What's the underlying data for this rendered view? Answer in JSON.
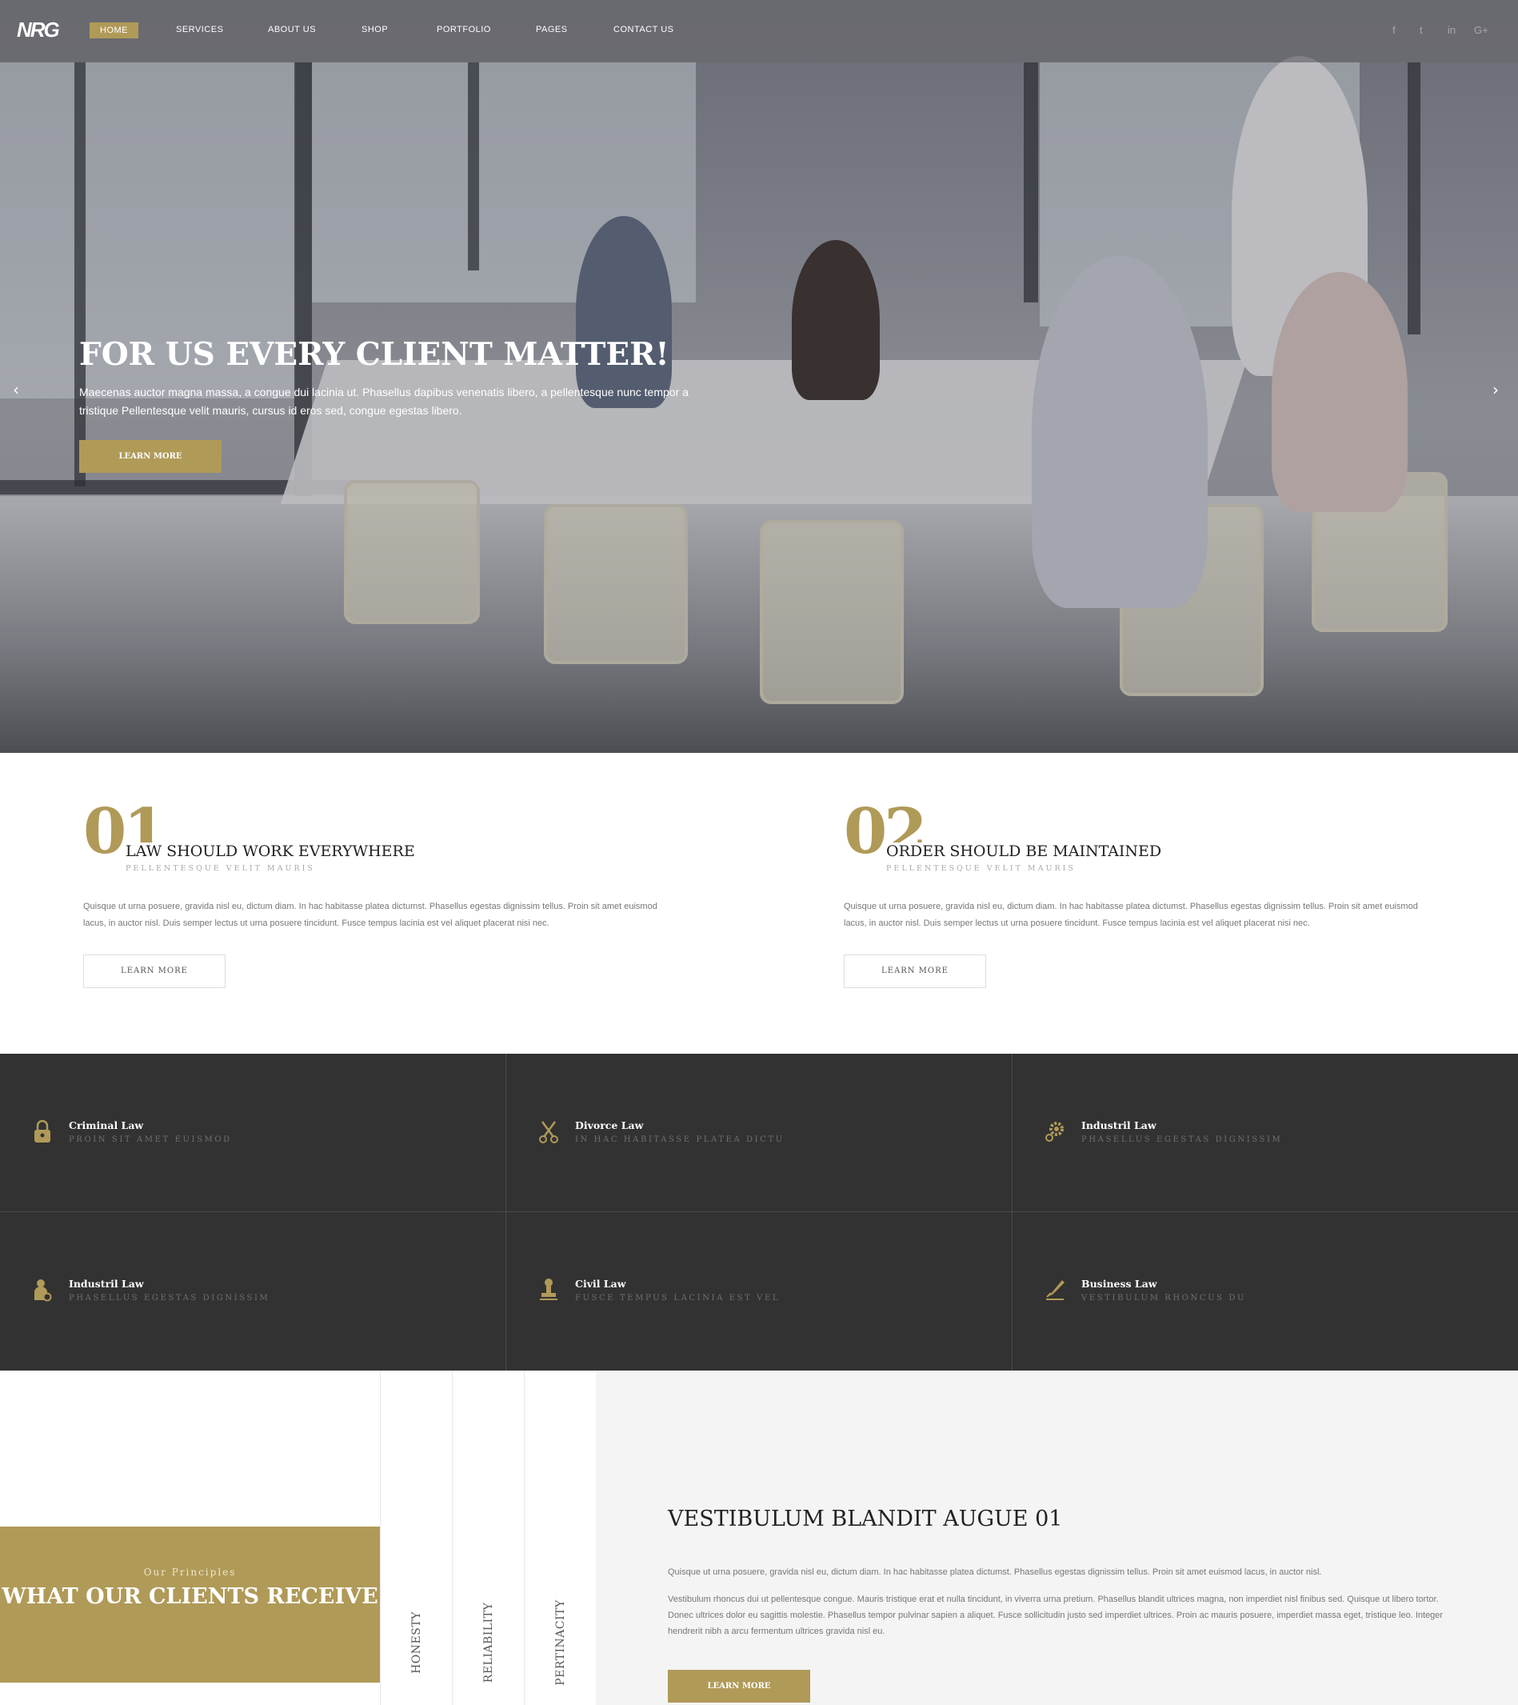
{
  "brand": {
    "logo_text": "NRG",
    "accent_color": "#b09a58",
    "dark_color": "#323232"
  },
  "nav": {
    "items": [
      {
        "label": "HOME",
        "active": true
      },
      {
        "label": "SERVICES"
      },
      {
        "label": "ABOUT US"
      },
      {
        "label": "SHOP"
      },
      {
        "label": "PORTFOLIO"
      },
      {
        "label": "PAGES"
      },
      {
        "label": "CONTACT US"
      }
    ],
    "social": [
      {
        "icon": "facebook-icon",
        "glyph": "f"
      },
      {
        "icon": "twitter-icon",
        "glyph": "t"
      },
      {
        "icon": "linkedin-icon",
        "glyph": "in"
      },
      {
        "icon": "google-plus-icon",
        "glyph": "G+"
      }
    ]
  },
  "hero": {
    "title": "FOR US EVERY CLIENT MATTER!",
    "text": "Maecenas auctor magna massa, a congue dui lacinia ut. Phasellus dapibus venenatis libero, a pellentesque nunc tempor a tristique Pellentesque velit mauris, cursus id eros sed, congue egestas libero.",
    "button": "LEARN MORE",
    "prev_arrow": "‹",
    "next_arrow": "›"
  },
  "features": [
    {
      "number": "01",
      "title": "LAW SHOULD WORK EVERYWHERE",
      "subtitle": "PELLENTESQUE VELIT MAURIS",
      "text": "Quisque ut urna posuere, gravida nisl eu, dictum diam. In hac habitasse platea dictumst. Phasellus egestas dignissim tellus. Proin sit amet euismod lacus, in auctor nisl. Duis semper lectus ut urna posuere tincidunt. Fusce tempus lacinia est vel aliquet placerat nisi nec.",
      "button": "LEARN MORE"
    },
    {
      "number": "02",
      "title": "ORDER SHOULD BE MAINTAINED",
      "subtitle": "PELLENTESQUE VELIT MAURIS",
      "text": "Quisque ut urna posuere, gravida nisl eu, dictum diam. In hac habitasse platea dictumst. Phasellus egestas dignissim tellus. Proin sit amet euismod lacus, in auctor nisl. Duis semper lectus ut urna posuere tincidunt. Fusce tempus lacinia est vel aliquet placerat nisi nec.",
      "button": "LEARN MORE"
    }
  ],
  "services": [
    {
      "name": "Criminal Law",
      "subtitle": "PROIN SIT AMET EUISMOD",
      "icon": "padlock-icon"
    },
    {
      "name": "Divorce Law",
      "subtitle": "IN HAC HABITASSE PLATEA DICTU",
      "icon": "scissors-icon"
    },
    {
      "name": "Industril Law",
      "subtitle": "PHASELLUS EGESTAS DIGNISSIM",
      "icon": "gear-icon"
    },
    {
      "name": "Industril Law",
      "subtitle": "PHASELLUS EGESTAS DIGNISSIM",
      "icon": "worker-icon"
    },
    {
      "name": "Civil Law",
      "subtitle": "FUSCE TEMPUS LACINIA EST VEL",
      "icon": "stamp-icon"
    },
    {
      "name": "Business Law",
      "subtitle": "VESTIBULUM RHONCUS DU",
      "icon": "pen-icon"
    }
  ],
  "principles": {
    "tag": "Our Principles",
    "title": "WHAT OUR CLIENTS RECEIVE",
    "tabs": [
      "HONESTY",
      "RELIABILITY",
      "PERTINACITY"
    ],
    "content_title": "VESTIBULUM BLANDIT AUGUE 01",
    "paragraph1": "Quisque ut urna posuere, gravida nisl eu, dictum diam. In hac habitasse platea dictumst. Phasellus egestas dignissim tellus. Proin sit amet euismod lacus, in auctor nisl.",
    "paragraph2": "Vestibulum rhoncus dui ut pellentesque congue. Mauris tristique erat et nulla tincidunt, in viverra urna pretium. Phasellus blandit ultrices magna, non imperdiet nisl finibus sed. Quisque ut libero tortor. Donec ultrices dolor eu sagittis molestie. Phasellus tempor pulvinar sapien a aliquet. Fusce sollicitudin justo sed imperdiet ultrices. Proin ac mauris posuere, imperdiet massa eget, tristique leo. Integer hendrerit nibh a arcu fermentum ultrices gravida nisl eu.",
    "button": "LEARN MORE"
  }
}
